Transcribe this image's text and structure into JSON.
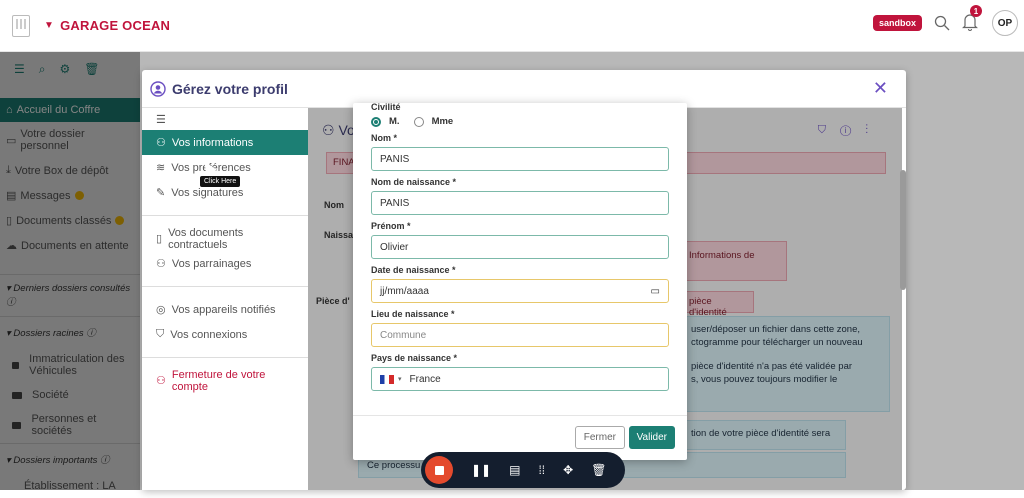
{
  "topbar": {
    "brand": "GARAGE OCEAN",
    "sandbox_badge": "sandbox",
    "notif_count": "1",
    "avatar_initials": "OP"
  },
  "sidebar": {
    "items": [
      {
        "label": "Accueil du Coffre",
        "icon": "home-icon"
      },
      {
        "label": "Votre dossier personnel",
        "icon": "folder-icon"
      },
      {
        "label": "Votre Box de dépôt",
        "icon": "download-icon"
      },
      {
        "label": "Messages",
        "icon": "message-icon"
      },
      {
        "label": "Documents classés",
        "icon": "document-icon"
      },
      {
        "label": "Documents en attente",
        "icon": "cloud-icon"
      }
    ],
    "sections": {
      "recent": "Derniers dossiers consultés",
      "root": "Dossiers racines",
      "important": "Dossiers importants"
    },
    "folders": [
      "Immatriculation des Véhicules",
      "Société",
      "Personnes et sociétés"
    ],
    "important_items": [
      "Établissement : LA"
    ]
  },
  "modal": {
    "title": "Gérez votre profil",
    "menu": [
      {
        "label": "Vos informations"
      },
      {
        "label": "Vos préférences"
      },
      {
        "label": "Vos signatures"
      },
      {
        "label": "Vos documents contractuels"
      },
      {
        "label": "Vos parrainages"
      },
      {
        "label": "Vos appareils notifiés"
      },
      {
        "label": "Vos connexions"
      },
      {
        "label": "Fermeture de votre compte"
      }
    ],
    "tooltip": "Click Here",
    "behind": {
      "heading": "Vo",
      "badge": "FINA",
      "label_nom": "Nom",
      "label_naissance": "Naissan",
      "label_piece": "Pièce d'",
      "pink_info": "Informations de",
      "pink_piece": "pièce d'identité",
      "blue_1_a": "user/déposer un fichier dans cette zone,",
      "blue_1_b": "ctogramme pour télécharger un nouveau",
      "blue_1_c": "pièce d'identité n'a pas été validée par",
      "blue_1_d": "s, vous pouvez toujours modifier le",
      "blue_2": "tion de votre pièce d'identité sera",
      "blue_3": "Ce processu"
    }
  },
  "form": {
    "civilite_label": "Civilité",
    "options": {
      "m": "M.",
      "mme": "Mme"
    },
    "nom_label": "Nom *",
    "nom_value": "PANIS",
    "nom_naissance_label": "Nom de naissance *",
    "nom_naissance_value": "PANIS",
    "prenom_label": "Prénom *",
    "prenom_value": "Olivier",
    "date_label": "Date de naissance *",
    "date_placeholder": "jj/mm/aaaa",
    "lieu_label": "Lieu de naissance *",
    "lieu_placeholder": "Commune",
    "pays_label": "Pays de naissance *",
    "pays_value": "France",
    "fermer": "Fermer",
    "valider": "Valider"
  }
}
